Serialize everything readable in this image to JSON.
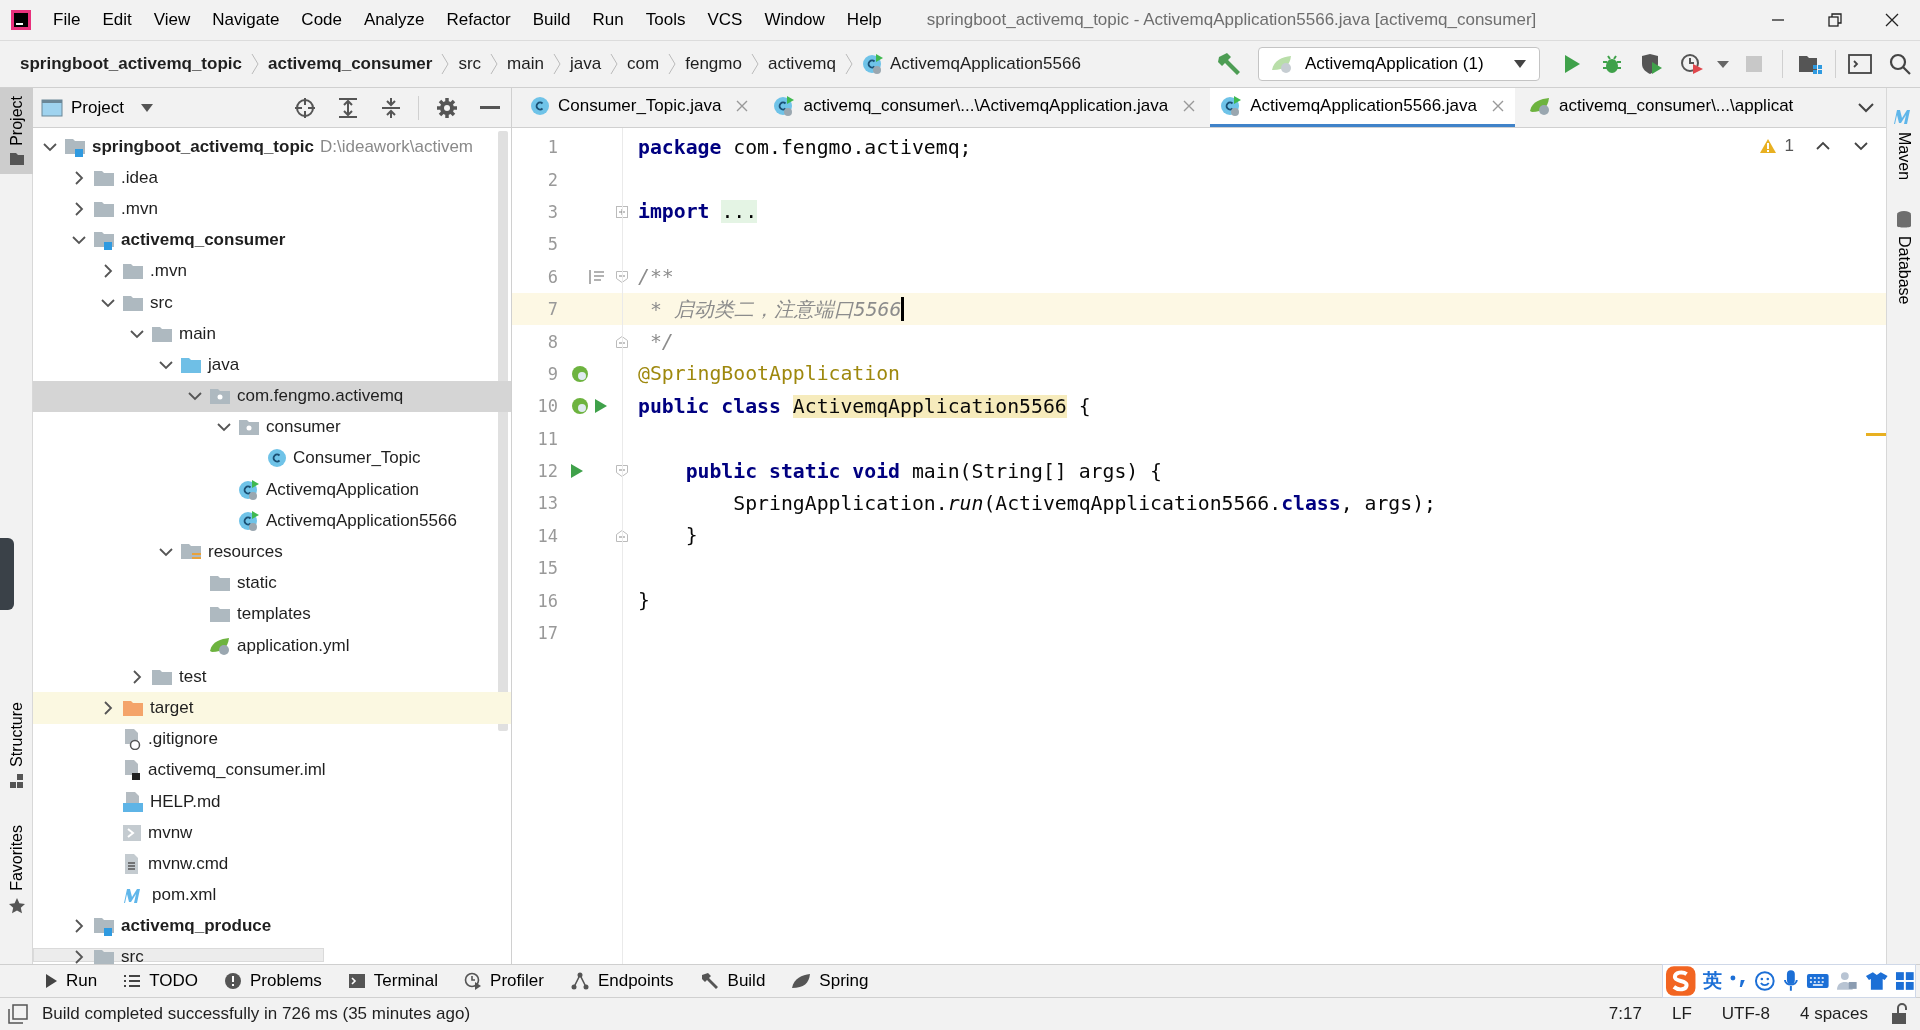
{
  "window": {
    "title": "springboot_activemq_topic - ActivemqApplication5566.java [activemq_consumer]"
  },
  "menu": [
    "File",
    "Edit",
    "View",
    "Navigate",
    "Code",
    "Analyze",
    "Refactor",
    "Build",
    "Run",
    "Tools",
    "VCS",
    "Window",
    "Help"
  ],
  "breadcrumbs": [
    {
      "label": "springboot_activemq_topic",
      "bold": true,
      "kind": "plain"
    },
    {
      "label": "activemq_consumer",
      "bold": true,
      "kind": "plain"
    },
    {
      "label": "src",
      "bold": false,
      "kind": "plain"
    },
    {
      "label": "main",
      "bold": false,
      "kind": "plain"
    },
    {
      "label": "java",
      "bold": false,
      "kind": "plain"
    },
    {
      "label": "com",
      "bold": false,
      "kind": "plain"
    },
    {
      "label": "fengmo",
      "bold": false,
      "kind": "plain"
    },
    {
      "label": "activemq",
      "bold": false,
      "kind": "plain"
    },
    {
      "label": "ActivemqApplication5566",
      "bold": false,
      "kind": "spring-class"
    }
  ],
  "run_config": {
    "label": "ActivemqApplication (1)"
  },
  "toolbar": [
    {
      "kind": "run",
      "disabled": false
    },
    {
      "kind": "debug",
      "disabled": false
    },
    {
      "kind": "coverage",
      "disabled": false
    },
    {
      "kind": "profile",
      "disabled": false
    },
    {
      "kind": "more",
      "disabled": false
    },
    {
      "kind": "stop",
      "disabled": true
    }
  ],
  "left_stripe": [
    {
      "label": "Project",
      "selected": true
    },
    {
      "label": "Structure",
      "selected": false
    },
    {
      "label": "Favorites",
      "selected": false
    }
  ],
  "right_stripe": [
    {
      "label": "Maven",
      "kind": "maven"
    },
    {
      "label": "Database",
      "kind": "database"
    }
  ],
  "project_panel": {
    "title": "Project",
    "tree": [
      {
        "label": "springboot_activemq_topic",
        "hint": "D:\\ideawork\\activem",
        "kind": "module",
        "bold": true,
        "selected": false,
        "highlighted": false,
        "expanded": true,
        "children": [
          {
            "label": ".idea",
            "kind": "folder",
            "bold": false,
            "selected": false,
            "highlighted": false,
            "expanded": false
          },
          {
            "label": ".mvn",
            "kind": "folder",
            "bold": false,
            "selected": false,
            "highlighted": false,
            "expanded": false
          },
          {
            "label": "activemq_consumer",
            "kind": "module",
            "bold": true,
            "selected": false,
            "highlighted": false,
            "expanded": true,
            "children": [
              {
                "label": ".mvn",
                "kind": "folder",
                "bold": false,
                "selected": false,
                "highlighted": false,
                "expanded": false
              },
              {
                "label": "src",
                "kind": "folder",
                "bold": false,
                "selected": false,
                "highlighted": false,
                "expanded": true,
                "children": [
                  {
                    "label": "main",
                    "kind": "folder",
                    "bold": false,
                    "selected": false,
                    "highlighted": false,
                    "expanded": true,
                    "children": [
                      {
                        "label": "java",
                        "kind": "source-folder",
                        "bold": false,
                        "selected": false,
                        "highlighted": false,
                        "expanded": true,
                        "children": [
                          {
                            "label": "com.fengmo.activemq",
                            "kind": "package",
                            "bold": false,
                            "selected": true,
                            "highlighted": false,
                            "expanded": true,
                            "children": [
                              {
                                "label": "consumer",
                                "kind": "package",
                                "bold": false,
                                "selected": false,
                                "highlighted": false,
                                "expanded": true,
                                "children": [
                                  {
                                    "label": "Consumer_Topic",
                                    "kind": "class",
                                    "bold": false,
                                    "selected": false,
                                    "highlighted": false
                                  }
                                ]
                              },
                              {
                                "label": "ActivemqApplication",
                                "kind": "spring-class",
                                "bold": false,
                                "selected": false,
                                "highlighted": false
                              },
                              {
                                "label": "ActivemqApplication5566",
                                "kind": "spring-class",
                                "bold": false,
                                "selected": false,
                                "highlighted": false
                              }
                            ]
                          }
                        ]
                      },
                      {
                        "label": "resources",
                        "kind": "resources",
                        "bold": false,
                        "selected": false,
                        "highlighted": false,
                        "expanded": true,
                        "children": [
                          {
                            "label": "static",
                            "kind": "folder",
                            "bold": false,
                            "selected": false,
                            "highlighted": false
                          },
                          {
                            "label": "templates",
                            "kind": "folder",
                            "bold": false,
                            "selected": false,
                            "highlighted": false
                          },
                          {
                            "label": "application.yml",
                            "kind": "spring-config",
                            "bold": false,
                            "selected": false,
                            "highlighted": false
                          }
                        ]
                      }
                    ]
                  },
                  {
                    "label": "test",
                    "kind": "folder",
                    "bold": false,
                    "selected": false,
                    "highlighted": false,
                    "expanded": false
                  }
                ]
              },
              {
                "label": "target",
                "kind": "excluded",
                "bold": false,
                "selected": false,
                "highlighted": true,
                "expanded": false
              },
              {
                "label": ".gitignore",
                "kind": "gitignore",
                "bold": false,
                "selected": false,
                "highlighted": false
              },
              {
                "label": "activemq_consumer.iml",
                "kind": "iml",
                "bold": false,
                "selected": false,
                "highlighted": false
              },
              {
                "label": "HELP.md",
                "kind": "markdown",
                "bold": false,
                "selected": false,
                "highlighted": false
              },
              {
                "label": "mvnw",
                "kind": "script",
                "bold": false,
                "selected": false,
                "highlighted": false
              },
              {
                "label": "mvnw.cmd",
                "kind": "cmd",
                "bold": false,
                "selected": false,
                "highlighted": false
              },
              {
                "label": "pom.xml",
                "kind": "maven",
                "bold": false,
                "selected": false,
                "highlighted": false
              }
            ]
          },
          {
            "label": "activemq_produce",
            "kind": "module",
            "bold": true,
            "selected": false,
            "highlighted": false,
            "expanded": false
          },
          {
            "label": "src",
            "kind": "folder",
            "bold": false,
            "selected": false,
            "highlighted": false,
            "expanded": false
          }
        ]
      }
    ]
  },
  "tabs": [
    {
      "label": "Consumer_Topic.java",
      "kind": "class",
      "selected": false,
      "closable": true
    },
    {
      "label": "activemq_consumer\\...\\ActivemqApplication.java",
      "kind": "spring-class",
      "selected": false,
      "closable": true
    },
    {
      "label": "ActivemqApplication5566.java",
      "kind": "spring-class",
      "selected": true,
      "closable": true
    },
    {
      "label": "activemq_consumer\\...\\applicat",
      "kind": "spring-config",
      "selected": false,
      "closable": false
    }
  ],
  "editor": {
    "warnings": "1",
    "lines": [
      {
        "num": "1",
        "current": false,
        "tokens": [
          {
            "text": "package",
            "kind": "keyword"
          },
          {
            "text": " com.fengmo.activemq;",
            "kind": "plain"
          }
        ]
      },
      {
        "num": "2",
        "current": false
      },
      {
        "num": "3",
        "current": false,
        "gutter_icons": [
          {
            "kind": "fold-collapsed"
          }
        ],
        "tokens": [
          {
            "text": "import",
            "kind": "keyword"
          },
          {
            "text": "...",
            "kind": "folded"
          }
        ]
      },
      {
        "num": "5",
        "current": false
      },
      {
        "num": "6",
        "current": false,
        "gutter_icons": [
          {
            "kind": "doc"
          },
          {
            "kind": "fold-start"
          }
        ],
        "tokens": [
          {
            "text": "/**",
            "kind": "comment"
          }
        ]
      },
      {
        "num": "7",
        "current": true,
        "tokens": [
          {
            "text": " * 启动类二，注意端口5566",
            "kind": "comment"
          }
        ]
      },
      {
        "num": "8",
        "current": false,
        "gutter_icons": [
          {
            "kind": "fold-end"
          }
        ],
        "tokens": [
          {
            "text": " */",
            "kind": "comment"
          }
        ]
      },
      {
        "num": "9",
        "current": false,
        "gutter_icons": [
          {
            "kind": "bean"
          }
        ],
        "tokens": [
          {
            "text": "@SpringBootApplication",
            "kind": "annotation"
          }
        ]
      },
      {
        "num": "10",
        "current": false,
        "gutter_icons": [
          {
            "kind": "bean"
          },
          {
            "kind": "run"
          }
        ],
        "tokens": [
          {
            "text": "public class",
            "kind": "keyword"
          },
          {
            "text": "ActivemqApplication5566",
            "kind": "highlight"
          },
          {
            "text": " {",
            "kind": "plain"
          }
        ]
      },
      {
        "num": "11",
        "current": false
      },
      {
        "num": "12",
        "current": false,
        "gutter_icons": [
          {
            "kind": "run"
          },
          {
            "kind": "fold-start"
          }
        ],
        "tokens": [
          {
            "text": "    public static void",
            "kind": "keyword"
          },
          {
            "text": " main(String[] args) {",
            "kind": "plain"
          }
        ]
      },
      {
        "num": "13",
        "current": false,
        "tokens": [
          {
            "text": "        SpringApplication.",
            "kind": "plain"
          },
          {
            "text": "run",
            "kind": "static"
          },
          {
            "text": "(ActivemqApplication5566.",
            "kind": "plain"
          },
          {
            "text": "class",
            "kind": "keyword"
          },
          {
            "text": ", args);",
            "kind": "plain"
          }
        ]
      },
      {
        "num": "14",
        "current": false,
        "gutter_icons": [
          {
            "kind": "fold-end"
          }
        ],
        "tokens": [
          {
            "text": "    }",
            "kind": "plain"
          }
        ]
      },
      {
        "num": "15",
        "current": false
      },
      {
        "num": "16",
        "current": false,
        "tokens": [
          {
            "text": "}",
            "kind": "plain"
          }
        ]
      },
      {
        "num": "17",
        "current": false
      }
    ]
  },
  "bottom_tools": [
    {
      "label": "Run",
      "kind": "run"
    },
    {
      "label": "TODO",
      "kind": "list"
    },
    {
      "label": "Problems",
      "kind": "problems"
    },
    {
      "label": "Terminal",
      "kind": "terminal"
    },
    {
      "label": "Profiler",
      "kind": "profiler"
    },
    {
      "label": "Endpoints",
      "kind": "endpoints"
    },
    {
      "label": "Build",
      "kind": "hammer"
    },
    {
      "label": "Spring",
      "kind": "leaf"
    }
  ],
  "ime_bar": {
    "label": "英"
  },
  "status_bar": {
    "message": "Build completed successfully in 726 ms (35 minutes ago)",
    "items": [
      "7:17",
      "LF",
      "UTF-8",
      "4 spaces"
    ]
  }
}
